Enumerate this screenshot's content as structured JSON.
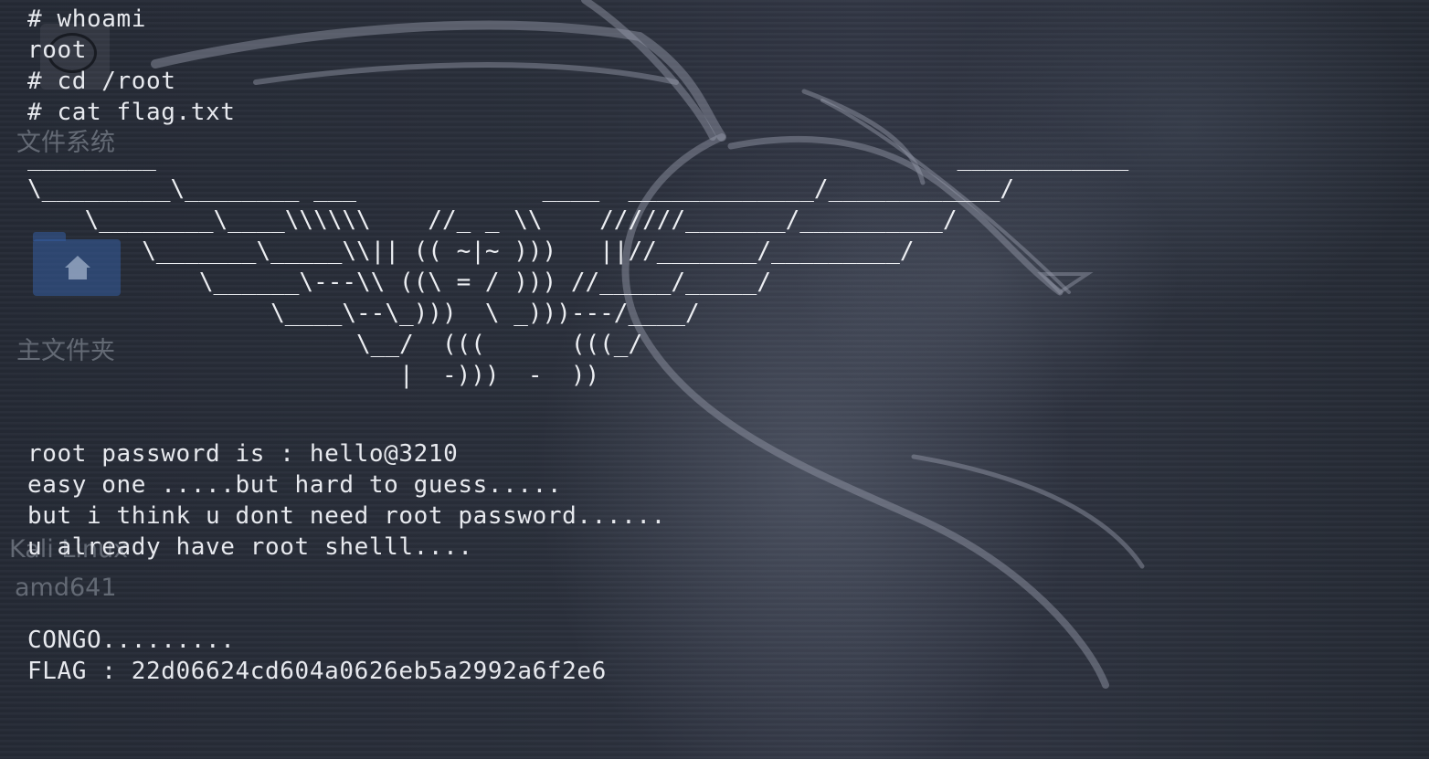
{
  "terminal": {
    "commands": [
      "# whoami",
      "root",
      "# cd /root",
      "# cat flag.txt"
    ],
    "ascii_art": [
      "_________                                                        ____________",
      "\\_________\\________ ___             ____  _____________/____________/",
      "    \\________\\____\\\\\\\\\\\\    //_ _ \\\\    //////_______/__________/",
      "        \\_______\\_____\\\\|| (( ~|~ )))   ||//_______/_________/",
      "            \\______\\---\\\\ ((\\ = / ))) //_____/_____/",
      "                 \\____\\--\\_)))  \\ _)))---/____/",
      "                       \\__/  (((      (((_/",
      "                          |  -)))  -  ))"
    ],
    "message": [
      "root password is : hello@3210",
      "easy one .....but hard to guess.....",
      "but i think u dont need root password......",
      "u already have root shelll...."
    ],
    "congrats": "CONGO.........",
    "flag": "FLAG : 22d06624cd604a0626eb5a2992a6f2e6"
  },
  "desktop": {
    "icons": [
      {
        "label": "文件系统",
        "icon": "drive-icon"
      },
      {
        "label": "主文件夹",
        "icon": "home-folder-icon"
      },
      {
        "label": "Kali Linux amd641",
        "icon": "disc-icon"
      }
    ],
    "kali_label_line1": "Kali Linux",
    "kali_label_line2": "amd641"
  },
  "colors": {
    "terminal_text": "#e7e9ee",
    "background": "#2a2f3b",
    "folder_accent": "#345ca0"
  }
}
